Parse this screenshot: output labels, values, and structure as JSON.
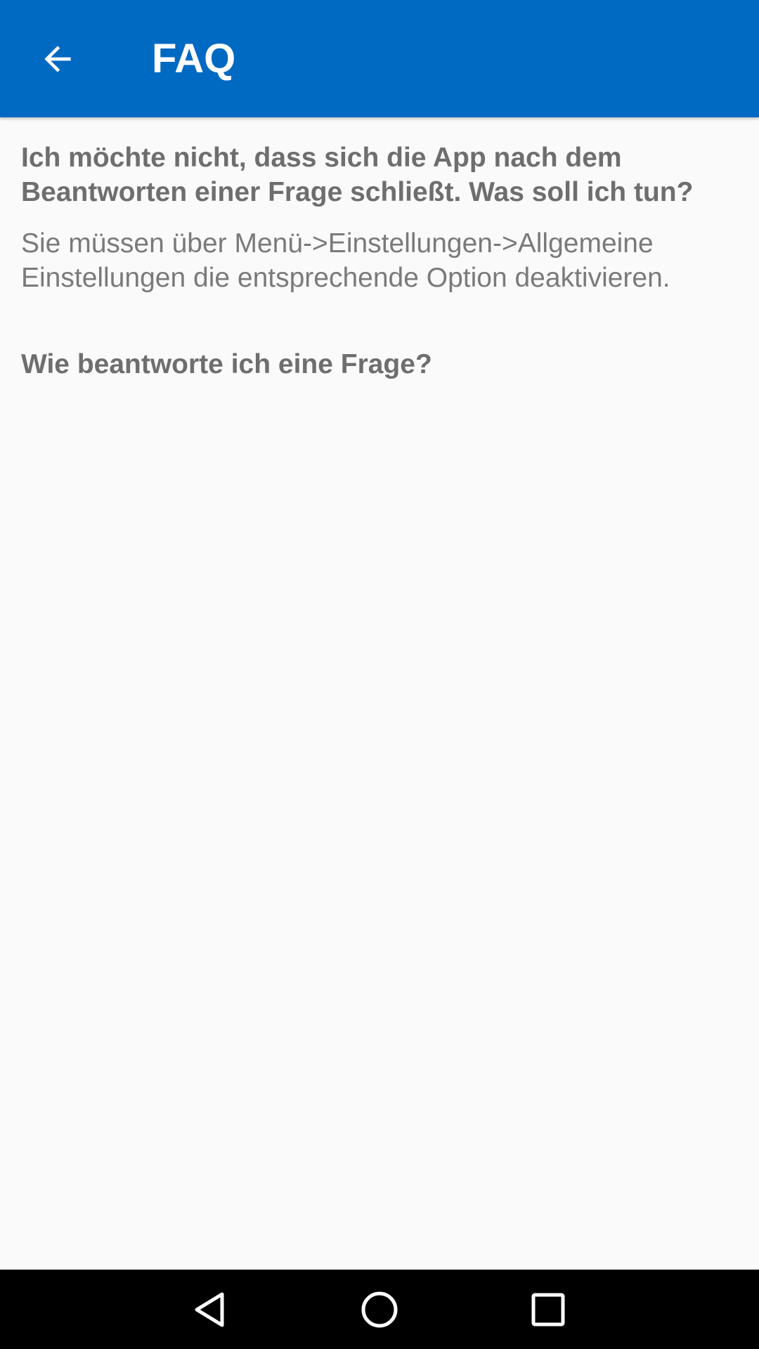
{
  "app_bar": {
    "title": "FAQ",
    "back_icon": "arrow-left-icon",
    "color": "#0069c2"
  },
  "faq": [
    {
      "question": "Ich möchte nicht, dass sich die App nach dem Beantworten einer Frage schließt. Was soll ich tun?",
      "answer": "Sie müssen über Menü->Einstellungen->Allgemeine Einstellungen die entsprechende Option deaktivieren."
    },
    {
      "question": "Wie beantworte ich eine Frage?"
    }
  ],
  "nav_bar": {
    "back_icon": "triangle-back-icon",
    "home_icon": "circle-home-icon",
    "recents_icon": "square-recents-icon"
  }
}
